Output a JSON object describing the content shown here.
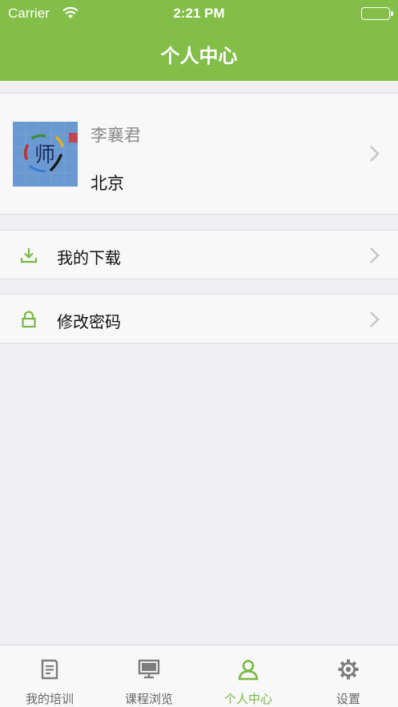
{
  "status_bar": {
    "carrier": "Carrier",
    "time": "2:21 PM"
  },
  "header": {
    "title": "个人中心"
  },
  "profile": {
    "name": "李襄君",
    "city": "北京",
    "avatar_text": "师"
  },
  "menu": [
    {
      "label": "我的下载",
      "icon": "download-icon"
    },
    {
      "label": "修改密码",
      "icon": "lock-icon"
    }
  ],
  "tabs": [
    {
      "label": "我的培训",
      "icon": "document-icon",
      "active": false
    },
    {
      "label": "课程浏览",
      "icon": "monitor-icon",
      "active": false
    },
    {
      "label": "个人中心",
      "icon": "person-icon",
      "active": true
    },
    {
      "label": "设置",
      "icon": "gear-icon",
      "active": false
    }
  ],
  "colors": {
    "accent": "#82be48",
    "tab_active": "#7ab843",
    "background": "#f0f0f4"
  }
}
